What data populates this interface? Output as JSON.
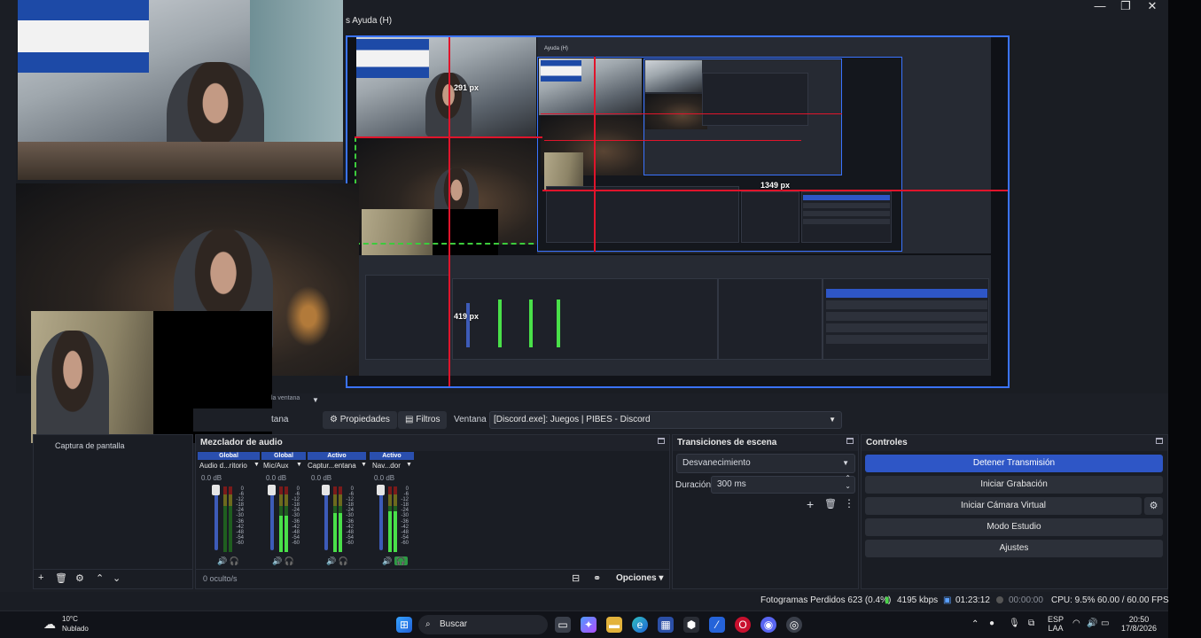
{
  "window": {
    "menu_help": "s   Ayuda (H)",
    "minimize": "—",
    "maximize": "❐",
    "close": "✕"
  },
  "preview": {
    "label_291": "291 px",
    "label_1349": "1349 px",
    "label_419": "419 px",
    "inner_menu": "Ayuda (H)"
  },
  "toolbar": {
    "hint_text": "la ventana",
    "window_partial": "tana",
    "properties": "Propiedades",
    "filters": "Filtros",
    "window_label": "Ventana",
    "window_value": "[Discord.exe]: Juegos | PIBES - Discord"
  },
  "sources": {
    "title": "",
    "items": [
      {
        "label": "Captura de pantalla"
      }
    ]
  },
  "audio": {
    "title": "Mezclador de audio",
    "channels": [
      {
        "tag": "Global",
        "name": "Audio d...ritorio",
        "db": "0.0 dB",
        "level": 0.0
      },
      {
        "tag": "Global",
        "name": "Mic/Aux",
        "db": "0.0 dB",
        "level": 0.55
      },
      {
        "tag": "Activo",
        "name": "Captur...entana",
        "db": "0.0 dB",
        "level": 0.6
      },
      {
        "tag": "Activo",
        "name": "Nav...dor",
        "db": "0.0 dB",
        "level": 0.62
      }
    ],
    "scale": [
      "0",
      "-6",
      "-12",
      "-18",
      "-24",
      "-30",
      "-36",
      "-42",
      "-48",
      "-54",
      "-60"
    ],
    "hidden_count": "0 oculto/s",
    "options": "Opciones"
  },
  "transitions": {
    "title": "Transiciones de escena",
    "selected": "Desvanecimiento",
    "duration_label": "Duración",
    "duration_value": "300 ms"
  },
  "controls": {
    "title": "Controles",
    "stop_stream": "Detener Transmisión",
    "start_recording": "Iniciar Grabación",
    "start_virtual_cam": "Iniciar Cámara Virtual",
    "studio_mode": "Modo Estudio",
    "settings": "Ajustes"
  },
  "status": {
    "dropped_frames": "Fotogramas Perdidos 623 (0.4%)",
    "bitrate": "4195 kbps",
    "stream_time": "01:23:12",
    "rec_time": "00:00:00",
    "cpu": "CPU: 9.5%",
    "fps": "60.00 / 60.00 FPS"
  },
  "taskbar": {
    "weather_temp": "10°C",
    "weather_desc": "Nublado",
    "search": "Buscar",
    "lang_top": "ESP",
    "lang_bottom": "LAA",
    "time": "20:50",
    "date": "17/8/2026"
  }
}
